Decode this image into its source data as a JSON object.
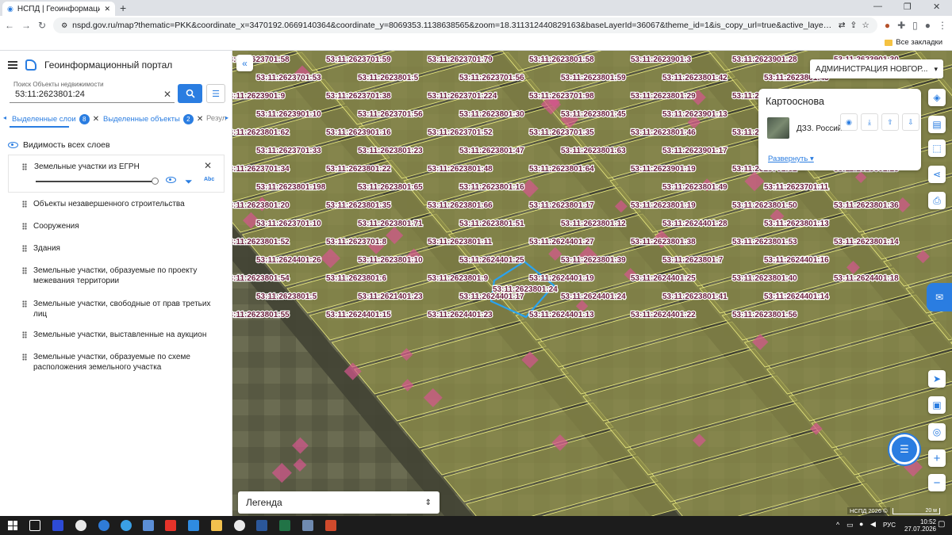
{
  "browser": {
    "tab_title": "НСПД | Геоинформационный",
    "url": "nspd.gov.ru/map?thematic=PKK&coordinate_x=3470192.0669140364&coordinate_y=8069353.1138638565&zoom=18.311312440829163&baseLayerId=36067&theme_id=1&is_copy_url=true&active_layers=36048%2C36329%2C36328%2C36049%2C36473%2C37298%...",
    "bookmarks_all": "Все закладки"
  },
  "sidebar": {
    "portal_title": "Геоинформационный портал",
    "search": {
      "label": "Поиск Объекты недвижимости",
      "value": "53:11:2623801:24"
    },
    "tabs": [
      {
        "label": "Выделенные слои",
        "count": "8"
      },
      {
        "label": "Выделенные объекты",
        "count": "2"
      },
      {
        "label": "Резул"
      }
    ],
    "visibility_all": "Видимость всех слоев",
    "active_layer": "Земельные участки из ЕГРН",
    "layers": [
      "Объекты незавершенного строительства",
      "Сооружения",
      "Здания",
      "Земельные участки, образуемые по проекту межевания территории",
      "Земельные участки, свободные от прав третьих лиц",
      "Земельные участки, выставленные на аукцион",
      "Земельные участки, образуемые по схеме расположения земельного участка"
    ]
  },
  "map": {
    "admin_select": "АДМИНИСТРАЦИЯ НОВГОР...",
    "basemap": {
      "title": "Картооснова",
      "layer": "ДЗЗ. Россий",
      "expand": "Развернуть"
    },
    "legend": "Легенда",
    "attribution": "НСПД 2026 ©",
    "scale": "20 м",
    "selected_parcel": "53:11:2623801:24",
    "parcel_labels": [
      {
        "text": "53:11:2623701:58"
      },
      {
        "text": "53:11:2623701:59"
      },
      {
        "text": "53:11:2623701:79"
      },
      {
        "text": "53:11:2623801:58"
      },
      {
        "text": "53:11:2623901:3"
      },
      {
        "text": "53:11:2623901:28"
      },
      {
        "text": "53:11:2623901:30"
      },
      {
        "text": "53:11:2623701:53"
      },
      {
        "text": "53:11:2623801:5"
      },
      {
        "text": "53:11:2623701:56"
      },
      {
        "text": "53:11:2623801:59"
      },
      {
        "text": "53:11:2623801:42"
      },
      {
        "text": "53:11:2623701:57"
      },
      {
        "text": "53:11:2623801:43"
      },
      {
        "text": "53:11:2623901:9"
      },
      {
        "text": "53:11:2623701:38"
      },
      {
        "text": "53:11:2623701:224"
      },
      {
        "text": "53:11:2623701:98"
      },
      {
        "text": "53:11:2623801:29"
      },
      {
        "text": "53:11:2623801:44"
      },
      {
        "text": "53:11:2623801:61"
      },
      {
        "text": "53:11:2623901:10"
      },
      {
        "text": "53:11:2623701:56"
      },
      {
        "text": "53:11:2623801:30"
      },
      {
        "text": "53:11:2623801:45"
      },
      {
        "text": "53:11:2623901:13"
      },
      {
        "text": "53:11:2623701:36"
      },
      {
        "text": "53:11:2623801:31"
      },
      {
        "text": "53:11:2623801:62"
      },
      {
        "text": "53:11:2623901:16"
      },
      {
        "text": "53:11:2623701:52"
      },
      {
        "text": "53:11:2623701:35"
      },
      {
        "text": "53:11:2623801:46"
      },
      {
        "text": "53:11:2623901:15"
      },
      {
        "text": "53:11:2623801:27"
      },
      {
        "text": "53:11:2623701:33"
      },
      {
        "text": "53:11:2623801:23"
      },
      {
        "text": "53:11:2623801:47"
      },
      {
        "text": "53:11:2623801:63"
      },
      {
        "text": "53:11:2623901:17"
      },
      {
        "text": "53:11:2623801:26"
      },
      {
        "text": "53:11:2623801:34"
      },
      {
        "text": "53:11:2623701:34"
      },
      {
        "text": "53:11:2623801:22"
      },
      {
        "text": "53:11:2623801:48"
      },
      {
        "text": "53:11:2623801:64"
      },
      {
        "text": "53:11:2623901:19"
      },
      {
        "text": "53:11:2623701:32"
      },
      {
        "text": "53:11:2623801:25"
      },
      {
        "text": "53:11:2623801:198"
      },
      {
        "text": "53:11:2623801:65"
      },
      {
        "text": "53:11:2623801:16"
      },
      {
        "text": "53:11:2623801:24"
      },
      {
        "text": "53:11:2623801:49"
      },
      {
        "text": "53:11:2623901:21"
      },
      {
        "text": "53:11:2623701:11"
      },
      {
        "text": "53:11:2623801:20"
      },
      {
        "text": "53:11:2623801:35"
      },
      {
        "text": "53:11:2623801:66"
      },
      {
        "text": "53:11:2623801:17"
      },
      {
        "text": "53:11:2623801:19"
      },
      {
        "text": "53:11:2623801:50"
      },
      {
        "text": "53:11:2623801:36"
      },
      {
        "text": "53:11:2623701:10"
      },
      {
        "text": "53:11:2623801:71"
      },
      {
        "text": "53:11:2623801:51"
      },
      {
        "text": "53:11:2623801:12"
      },
      {
        "text": "53:11:2624401:28"
      },
      {
        "text": "53:11:2623801:37"
      },
      {
        "text": "53:11:2623801:13"
      },
      {
        "text": "53:11:2623801:52"
      },
      {
        "text": "53:11:2623701:8"
      },
      {
        "text": "53:11:2623801:11"
      },
      {
        "text": "53:11:2624401:27"
      },
      {
        "text": "53:11:2623801:38"
      },
      {
        "text": "53:11:2623801:53"
      },
      {
        "text": "53:11:2623801:14"
      },
      {
        "text": "53:11:2624401:26"
      },
      {
        "text": "53:11:2623801:10"
      },
      {
        "text": "53:11:2624401:25"
      },
      {
        "text": "53:11:2623801:39"
      },
      {
        "text": "53:11:2623801:7"
      },
      {
        "text": "53:11:2623801:70"
      },
      {
        "text": "53:11:2624401:16"
      },
      {
        "text": "53:11:2623801:54"
      },
      {
        "text": "53:11:2623801:6"
      },
      {
        "text": "53:11:2623801:9"
      },
      {
        "text": "53:11:2624401:19"
      },
      {
        "text": "53:11:2624401:25"
      },
      {
        "text": "53:11:2623801:40"
      },
      {
        "text": "53:11:2624401:18"
      },
      {
        "text": "53:11:2623801:5"
      },
      {
        "text": "53:11:2621401:23"
      },
      {
        "text": "53:11:2624401:17"
      },
      {
        "text": "53:11:2624401:24"
      },
      {
        "text": "53:11:2623801:41"
      },
      {
        "text": "53:11:2623801:2"
      },
      {
        "text": "53:11:2624401:14"
      },
      {
        "text": "53:11:2623801:55"
      },
      {
        "text": "53:11:2624401:15"
      },
      {
        "text": "53:11:2624401:23"
      },
      {
        "text": "53:11:2624401:13"
      },
      {
        "text": "53:11:2624401:22"
      },
      {
        "text": "53:11:2623801:56"
      }
    ]
  },
  "taskbar": {
    "lang": "РУС",
    "time": "10:52",
    "date": "27.07.2026"
  },
  "colors": {
    "accent": "#2a7de1",
    "parcel_fill": "#8f8f4a",
    "parcel_stroke": "#ecec80",
    "building": "#d6558f",
    "label": "#6b1f3c"
  }
}
